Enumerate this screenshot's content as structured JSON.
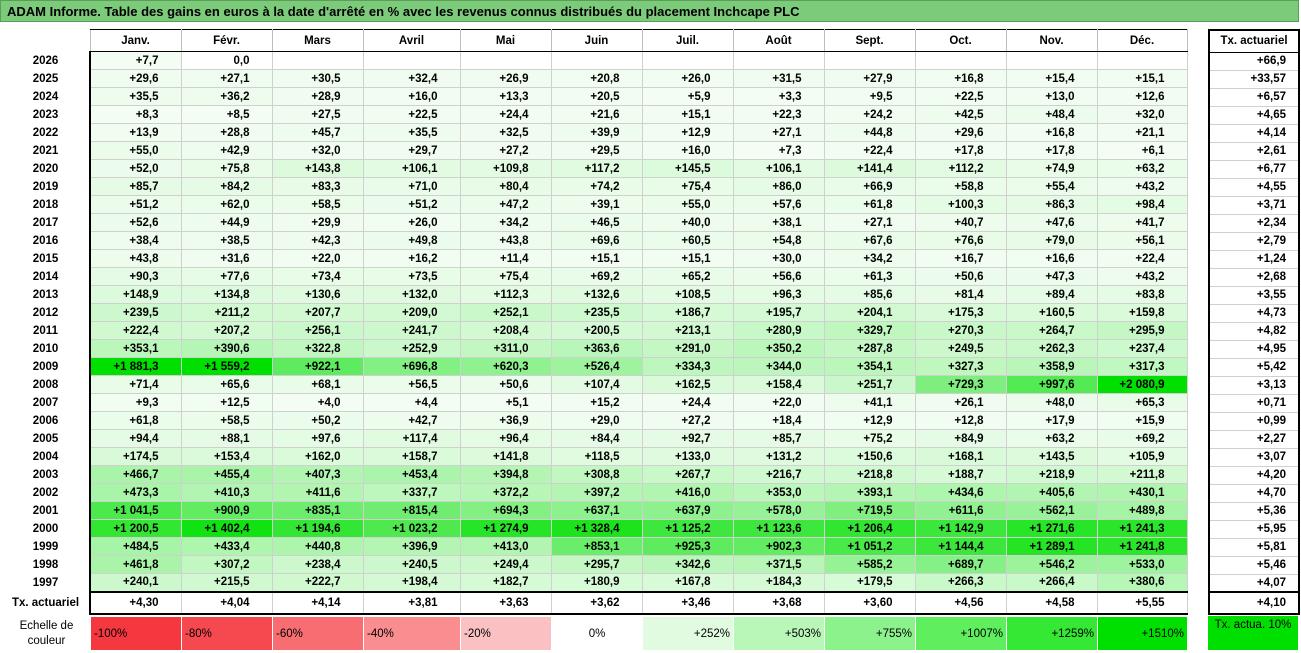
{
  "title": "ADAM Informe. Table des gains en euros à la date d'arrêté en % avec les revenus connus distribués du placement Inchcape PLC",
  "months": [
    "Janv.",
    "Févr.",
    "Mars",
    "Avril",
    "Mai",
    "Juin",
    "Juil.",
    "Août",
    "Sept.",
    "Oct.",
    "Nov.",
    "Déc."
  ],
  "actuarial_header": "Tx. actuariel",
  "rows": [
    {
      "year": "2026",
      "cells": [
        "+7,7",
        "0,0",
        "",
        "",
        "",
        "",
        "",
        "",
        "",
        "",
        "",
        ""
      ],
      "actuarial": "+66,9"
    },
    {
      "year": "2025",
      "cells": [
        "+29,6",
        "+27,1",
        "+30,5",
        "+32,4",
        "+26,9",
        "+20,8",
        "+26,0",
        "+31,5",
        "+27,9",
        "+16,8",
        "+15,4",
        "+15,1"
      ],
      "actuarial": "+33,57"
    },
    {
      "year": "2024",
      "cells": [
        "+35,5",
        "+36,2",
        "+28,9",
        "+16,0",
        "+13,3",
        "+20,5",
        "+5,9",
        "+3,3",
        "+9,5",
        "+22,5",
        "+13,0",
        "+12,6"
      ],
      "actuarial": "+6,57"
    },
    {
      "year": "2023",
      "cells": [
        "+8,3",
        "+8,5",
        "+27,5",
        "+22,5",
        "+24,4",
        "+21,6",
        "+15,1",
        "+22,3",
        "+24,2",
        "+42,5",
        "+48,4",
        "+32,0"
      ],
      "actuarial": "+4,65"
    },
    {
      "year": "2022",
      "cells": [
        "+13,9",
        "+28,8",
        "+45,7",
        "+35,5",
        "+32,5",
        "+39,9",
        "+12,9",
        "+27,1",
        "+44,8",
        "+29,6",
        "+16,8",
        "+21,1"
      ],
      "actuarial": "+4,14"
    },
    {
      "year": "2021",
      "cells": [
        "+55,0",
        "+42,9",
        "+32,0",
        "+29,7",
        "+27,2",
        "+29,5",
        "+16,0",
        "+7,3",
        "+22,4",
        "+17,8",
        "+17,8",
        "+6,1"
      ],
      "actuarial": "+2,61"
    },
    {
      "year": "2020",
      "cells": [
        "+52,0",
        "+75,8",
        "+143,8",
        "+106,1",
        "+109,8",
        "+117,2",
        "+145,5",
        "+106,1",
        "+141,4",
        "+112,2",
        "+74,9",
        "+63,2"
      ],
      "actuarial": "+6,77"
    },
    {
      "year": "2019",
      "cells": [
        "+85,7",
        "+84,2",
        "+83,3",
        "+71,0",
        "+80,4",
        "+74,2",
        "+75,4",
        "+86,0",
        "+66,9",
        "+58,8",
        "+55,4",
        "+43,2"
      ],
      "actuarial": "+4,55"
    },
    {
      "year": "2018",
      "cells": [
        "+51,2",
        "+62,0",
        "+58,5",
        "+51,2",
        "+47,2",
        "+39,1",
        "+55,0",
        "+57,6",
        "+61,8",
        "+100,3",
        "+86,3",
        "+98,4"
      ],
      "actuarial": "+3,71"
    },
    {
      "year": "2017",
      "cells": [
        "+52,6",
        "+44,9",
        "+29,9",
        "+26,0",
        "+34,2",
        "+46,5",
        "+40,0",
        "+38,1",
        "+27,1",
        "+40,7",
        "+47,6",
        "+41,7"
      ],
      "actuarial": "+2,34"
    },
    {
      "year": "2016",
      "cells": [
        "+38,4",
        "+38,5",
        "+42,3",
        "+49,8",
        "+43,8",
        "+69,6",
        "+60,5",
        "+54,8",
        "+67,6",
        "+76,6",
        "+79,0",
        "+56,1"
      ],
      "actuarial": "+2,79"
    },
    {
      "year": "2015",
      "cells": [
        "+43,8",
        "+31,6",
        "+22,0",
        "+16,2",
        "+11,4",
        "+15,1",
        "+15,1",
        "+30,0",
        "+34,2",
        "+16,7",
        "+16,6",
        "+22,4"
      ],
      "actuarial": "+1,24"
    },
    {
      "year": "2014",
      "cells": [
        "+90,3",
        "+77,6",
        "+73,4",
        "+73,5",
        "+75,4",
        "+69,2",
        "+65,2",
        "+56,6",
        "+61,3",
        "+50,6",
        "+47,3",
        "+43,2"
      ],
      "actuarial": "+2,68"
    },
    {
      "year": "2013",
      "cells": [
        "+148,9",
        "+134,8",
        "+130,6",
        "+132,0",
        "+112,3",
        "+132,6",
        "+108,5",
        "+96,3",
        "+85,6",
        "+81,4",
        "+89,4",
        "+83,8"
      ],
      "actuarial": "+3,55"
    },
    {
      "year": "2012",
      "cells": [
        "+239,5",
        "+211,2",
        "+207,7",
        "+209,0",
        "+252,1",
        "+235,5",
        "+186,7",
        "+195,7",
        "+204,1",
        "+175,3",
        "+160,5",
        "+159,8"
      ],
      "actuarial": "+4,73"
    },
    {
      "year": "2011",
      "cells": [
        "+222,4",
        "+207,2",
        "+256,1",
        "+241,7",
        "+208,4",
        "+200,5",
        "+213,1",
        "+280,9",
        "+329,7",
        "+270,3",
        "+264,7",
        "+295,9"
      ],
      "actuarial": "+4,82"
    },
    {
      "year": "2010",
      "cells": [
        "+353,1",
        "+390,6",
        "+322,8",
        "+252,9",
        "+311,0",
        "+363,6",
        "+291,0",
        "+350,2",
        "+287,8",
        "+249,5",
        "+262,3",
        "+237,4"
      ],
      "actuarial": "+4,95"
    },
    {
      "year": "2009",
      "cells": [
        "+1 881,3",
        "+1 559,2",
        "+922,1",
        "+696,8",
        "+620,3",
        "+526,4",
        "+334,3",
        "+344,0",
        "+354,1",
        "+327,3",
        "+358,9",
        "+317,3"
      ],
      "actuarial": "+5,42"
    },
    {
      "year": "2008",
      "cells": [
        "+71,4",
        "+65,6",
        "+68,1",
        "+56,5",
        "+50,6",
        "+107,4",
        "+162,5",
        "+158,4",
        "+251,7",
        "+729,3",
        "+997,6",
        "+2 080,9"
      ],
      "actuarial": "+3,13"
    },
    {
      "year": "2007",
      "cells": [
        "+9,3",
        "+12,5",
        "+4,0",
        "+4,4",
        "+5,1",
        "+15,2",
        "+24,4",
        "+22,0",
        "+41,1",
        "+26,1",
        "+48,0",
        "+65,3"
      ],
      "actuarial": "+0,71"
    },
    {
      "year": "2006",
      "cells": [
        "+61,8",
        "+58,5",
        "+50,2",
        "+42,7",
        "+36,9",
        "+29,0",
        "+27,2",
        "+18,4",
        "+12,9",
        "+12,8",
        "+17,9",
        "+15,9"
      ],
      "actuarial": "+0,99"
    },
    {
      "year": "2005",
      "cells": [
        "+94,4",
        "+88,1",
        "+97,6",
        "+117,4",
        "+96,4",
        "+84,4",
        "+92,7",
        "+85,7",
        "+75,2",
        "+84,9",
        "+63,2",
        "+69,2"
      ],
      "actuarial": "+2,27"
    },
    {
      "year": "2004",
      "cells": [
        "+174,5",
        "+153,4",
        "+162,0",
        "+158,7",
        "+141,8",
        "+118,5",
        "+133,0",
        "+131,2",
        "+150,6",
        "+168,1",
        "+143,5",
        "+105,9"
      ],
      "actuarial": "+3,07"
    },
    {
      "year": "2003",
      "cells": [
        "+466,7",
        "+455,4",
        "+407,3",
        "+453,4",
        "+394,8",
        "+308,8",
        "+267,7",
        "+216,7",
        "+218,8",
        "+188,7",
        "+218,9",
        "+211,8"
      ],
      "actuarial": "+4,20"
    },
    {
      "year": "2002",
      "cells": [
        "+473,3",
        "+410,3",
        "+411,6",
        "+337,7",
        "+372,2",
        "+397,2",
        "+416,0",
        "+353,0",
        "+393,1",
        "+434,6",
        "+405,6",
        "+430,1"
      ],
      "actuarial": "+4,70"
    },
    {
      "year": "2001",
      "cells": [
        "+1 041,5",
        "+900,9",
        "+835,1",
        "+815,4",
        "+694,3",
        "+637,1",
        "+637,9",
        "+578,0",
        "+719,5",
        "+611,6",
        "+562,1",
        "+489,8"
      ],
      "actuarial": "+5,36"
    },
    {
      "year": "2000",
      "cells": [
        "+1 200,5",
        "+1 402,4",
        "+1 194,6",
        "+1 023,2",
        "+1 274,9",
        "+1 328,4",
        "+1 125,2",
        "+1 123,6",
        "+1 206,4",
        "+1 142,9",
        "+1 271,6",
        "+1 241,3"
      ],
      "actuarial": "+5,95"
    },
    {
      "year": "1999",
      "cells": [
        "+484,5",
        "+433,4",
        "+440,8",
        "+396,9",
        "+413,0",
        "+853,1",
        "+925,3",
        "+902,3",
        "+1 051,2",
        "+1 144,4",
        "+1 289,1",
        "+1 241,8"
      ],
      "actuarial": "+5,81"
    },
    {
      "year": "1998",
      "cells": [
        "+461,8",
        "+307,2",
        "+238,4",
        "+240,5",
        "+249,4",
        "+295,7",
        "+342,6",
        "+371,5",
        "+585,2",
        "+689,7",
        "+546,2",
        "+533,0"
      ],
      "actuarial": "+5,46"
    },
    {
      "year": "1997",
      "cells": [
        "+240,1",
        "+215,5",
        "+222,7",
        "+198,4",
        "+182,7",
        "+180,9",
        "+167,8",
        "+184,3",
        "+179,5",
        "+266,3",
        "+266,4",
        "+380,6"
      ],
      "actuarial": "+4,07"
    }
  ],
  "footer": {
    "label": "Tx. actuariel",
    "cells": [
      "+4,30",
      "+4,04",
      "+4,14",
      "+3,81",
      "+3,63",
      "+3,62",
      "+3,46",
      "+3,68",
      "+3,60",
      "+4,56",
      "+4,58",
      "+5,55"
    ],
    "actuarial": "+4,10"
  },
  "scale": {
    "label": "Echelle de couleur",
    "items": [
      {
        "text": "-100%",
        "color": "#f5383f",
        "kind": "neg"
      },
      {
        "text": "-80%",
        "color": "#f5494f",
        "kind": "neg"
      },
      {
        "text": "-60%",
        "color": "#f76d71",
        "kind": "neg"
      },
      {
        "text": "-40%",
        "color": "#f98d90",
        "kind": "neg"
      },
      {
        "text": "-20%",
        "color": "#fbc0c2",
        "kind": "neg"
      },
      {
        "text": "0%",
        "color": "#ffffff",
        "kind": "zero"
      },
      {
        "text": "+252%",
        "color": "#e0fbe0",
        "kind": "pos"
      },
      {
        "text": "+503%",
        "color": "#b8f7b8",
        "kind": "pos"
      },
      {
        "text": "+755%",
        "color": "#8cf38c",
        "kind": "pos"
      },
      {
        "text": "+1007%",
        "color": "#5eee5e",
        "kind": "pos"
      },
      {
        "text": "+1259%",
        "color": "#34e834",
        "kind": "pos"
      },
      {
        "text": "+1510%",
        "color": "#00e000",
        "kind": "pos"
      }
    ],
    "actuarial_legend": "Tx. actua. 10%",
    "actuarial_legend_color": "#00e000"
  }
}
